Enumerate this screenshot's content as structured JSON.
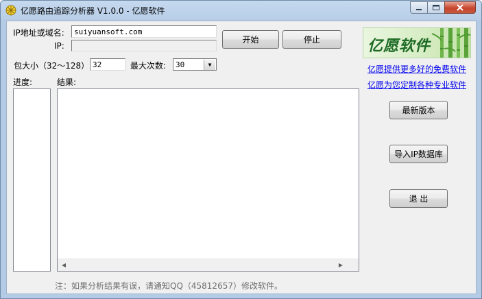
{
  "window": {
    "title": "亿愿路由追踪分析器 V1.0.0 - 亿愿软件"
  },
  "form": {
    "host_label": "IP地址或域名:",
    "host_value": "suiyuansoft.com",
    "ip_label": "IP:",
    "ip_value": "",
    "packet_label": "包大小（32～128）:",
    "packet_value": "32",
    "max_label": "最大次数:",
    "max_value": "30"
  },
  "buttons": {
    "start": "开始",
    "stop": "停止",
    "latest": "最新版本",
    "import_ip": "导入IP数据库",
    "exit": "退 出"
  },
  "panels": {
    "progress_label": "进度:",
    "result_label": "结果:"
  },
  "brand": {
    "logo_text": "亿愿软件"
  },
  "links": {
    "free": "亿愿提供更多好的免费软件",
    "custom": "亿愿为您定制各种专业软件"
  },
  "footer": {
    "note": "注：如果分析结果有误，请通知QQ（45812657）修改软件。"
  },
  "colors": {
    "link": "#0000ee",
    "close_button": "#c7442c",
    "logo_green": "#1c6a24"
  }
}
